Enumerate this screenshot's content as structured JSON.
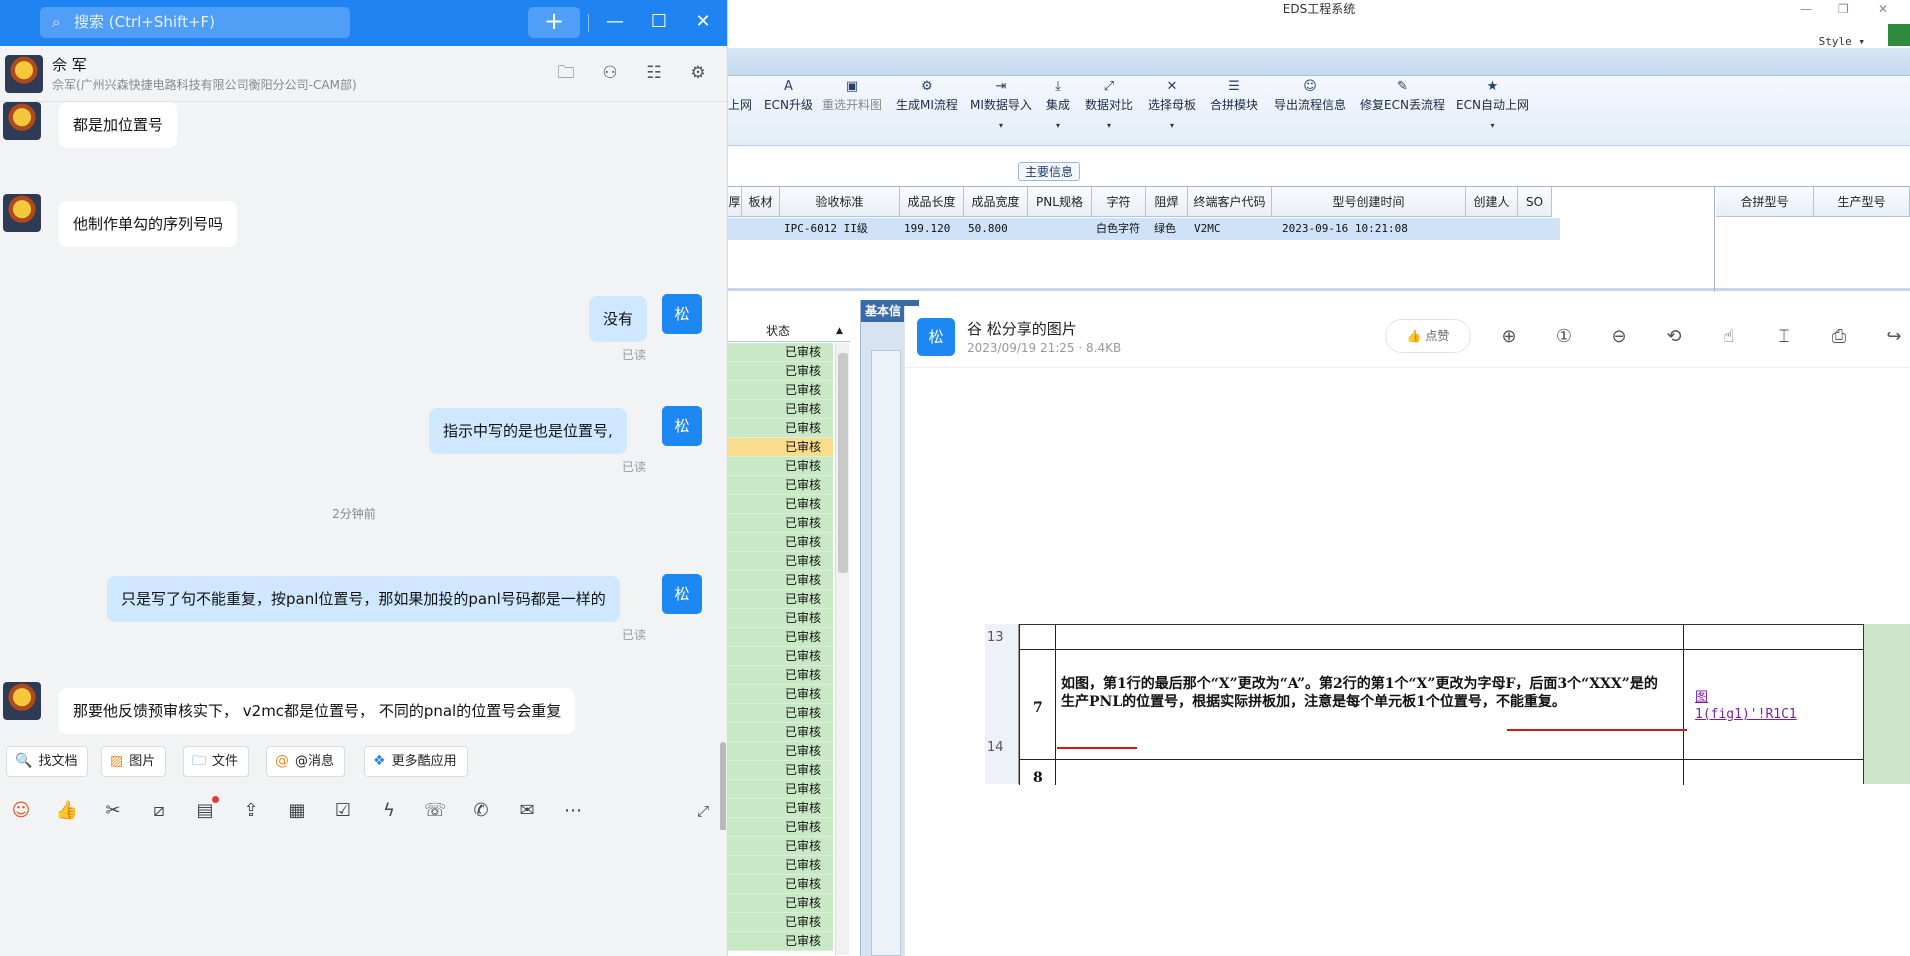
{
  "eds": {
    "title": "EDS工程系统",
    "style_label": "Style ▾",
    "ribbon": [
      {
        "label": "上网",
        "icon": ""
      },
      {
        "label": "ECN升级",
        "icon": "A"
      },
      {
        "label": "重选开料图",
        "icon": "▣"
      },
      {
        "label": "生成MI流程",
        "icon": "⚙"
      },
      {
        "label": "MI数据导入",
        "icon": "⇥"
      },
      {
        "label": "集成",
        "icon": "⤓"
      },
      {
        "label": "数据对比",
        "icon": "⤢"
      },
      {
        "label": "选择母板",
        "icon": "✕"
      },
      {
        "label": "合拼模块",
        "icon": "☰"
      },
      {
        "label": "导出流程信息",
        "icon": "☺"
      },
      {
        "label": "修复ECN丢流程",
        "icon": "🔧"
      },
      {
        "label": "ECN自动上网",
        "icon": "★"
      }
    ],
    "section_label": "主要信息",
    "grid_headers": [
      "厚",
      "板材",
      "验收标准",
      "成品长度",
      "成品宽度",
      "PNL规格",
      "字符",
      "阻焊",
      "终端客户代码",
      "型号创建时间",
      "创建人",
      "SO",
      "合拼型号",
      "生产型号"
    ],
    "grid_row": {
      "standard": "IPC-6012 II级",
      "length": "199.120",
      "width": "50.800",
      "char": "白色字符",
      "mask": "绿色",
      "customer": "V2MC",
      "created": "2023-09-16 10:21:08"
    },
    "status_header": "状态",
    "status_values": [
      "已审核",
      "已审核",
      "已审核",
      "已审核",
      "已审核",
      "已审核",
      "已审核",
      "已审核",
      "已审核",
      "已审核",
      "已审核",
      "已审核",
      "已审核",
      "已审核",
      "已审核",
      "已审核",
      "已审核",
      "已审核",
      "已审核",
      "已审核",
      "已审核",
      "已审核",
      "已审核",
      "已审核",
      "已审核",
      "已审核",
      "已审核",
      "已审核",
      "已审核",
      "已审核",
      "已审核",
      "已审核"
    ],
    "status_highlight_index": 5,
    "mid_tab": "基本信"
  },
  "viewer": {
    "avatar": "松",
    "title": "谷  松分享的图片",
    "meta": "2023/09/19 21:25 · 8.4KB",
    "like": "点赞",
    "tools": [
      "zoom-in-icon",
      "actual-size-icon",
      "zoom-out-icon",
      "rotate-icon",
      "hand-icon",
      "crop-text-icon",
      "print-icon",
      "share-icon"
    ],
    "doc": {
      "row13": "13",
      "row14": "14",
      "num7": "7",
      "num8": "8",
      "text": "如图，第1行的最后那个“X”更改为“A”。第2行的第1个“X”更改为字母F，后面3个“XXX”是的生产PNL的位置号，根据实际拼板加，注意是每个单元板1个位置号，不能重复。",
      "link_line1": "图",
      "link_line2": "1(fig1)'!R1C1"
    }
  },
  "chat": {
    "search_placeholder": "搜索 (Ctrl+Shift+F)",
    "contact_name": "佘 军",
    "contact_sub": "佘军(广州兴森快捷电路科技有限公司衡阳分公司-CAM部)",
    "self_avatar": "松",
    "messages": [
      {
        "dir": "in",
        "text": "都是加位置号"
      },
      {
        "dir": "in",
        "text": "他制作单勾的序列号吗"
      },
      {
        "dir": "out",
        "text": "没有",
        "status": "已读"
      },
      {
        "dir": "out",
        "text": "指示中写的是也是位置号,",
        "status": "已读"
      },
      {
        "dir": "out",
        "text": "只是写了句不能重复，按panl位置号，那如果加投的panl号码都是一样的",
        "status": "已读"
      },
      {
        "dir": "in",
        "text": "那要他反馈预审核实下，   v2mc都是位置号，  不同的pnal的位置号会重复"
      }
    ],
    "time_separator": "2分钟前",
    "quick_actions": [
      "找文档",
      "图片",
      "文件",
      "@消息",
      "更多酷应用"
    ]
  }
}
